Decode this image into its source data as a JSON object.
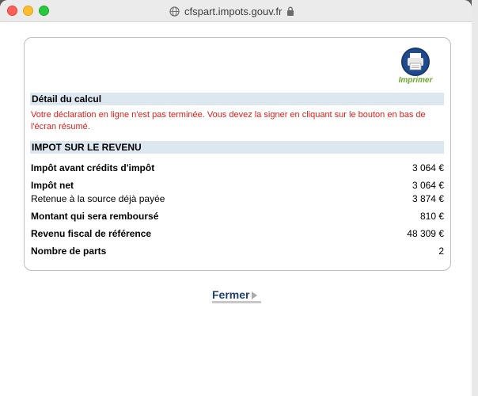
{
  "browser": {
    "url": "cfspart.impots.gouv.fr"
  },
  "print_button": {
    "label": "Imprimer"
  },
  "detail": {
    "heading": "Détail du calcul",
    "warning": "Votre déclaration en ligne n'est pas terminée. Vous devez la signer en cliquant sur le bouton en bas de l'écran résumé."
  },
  "impot": {
    "heading": "IMPOT SUR LE REVENU",
    "rows": [
      {
        "label": "Impôt avant crédits d'impôt",
        "value": "3 064 €",
        "bold": true
      },
      {
        "label": "Impôt net",
        "value": "3 064 €",
        "bold": true
      },
      {
        "label": "Retenue à la source déjà payée",
        "value": "3 874 €",
        "bold": false
      },
      {
        "label": "Montant qui sera remboursé",
        "value": "810 €",
        "bold": true
      },
      {
        "label": "Revenu fiscal de référence",
        "value": "48 309 €",
        "bold": true
      },
      {
        "label": "Nombre de parts",
        "value": "2",
        "bold": true
      }
    ]
  },
  "close_button": {
    "label": "Fermer"
  },
  "colors": {
    "section_bar": "#dde7f0",
    "warning_text": "#e0201b",
    "link_blue": "#1d3f72",
    "print_green": "#6aa829"
  }
}
